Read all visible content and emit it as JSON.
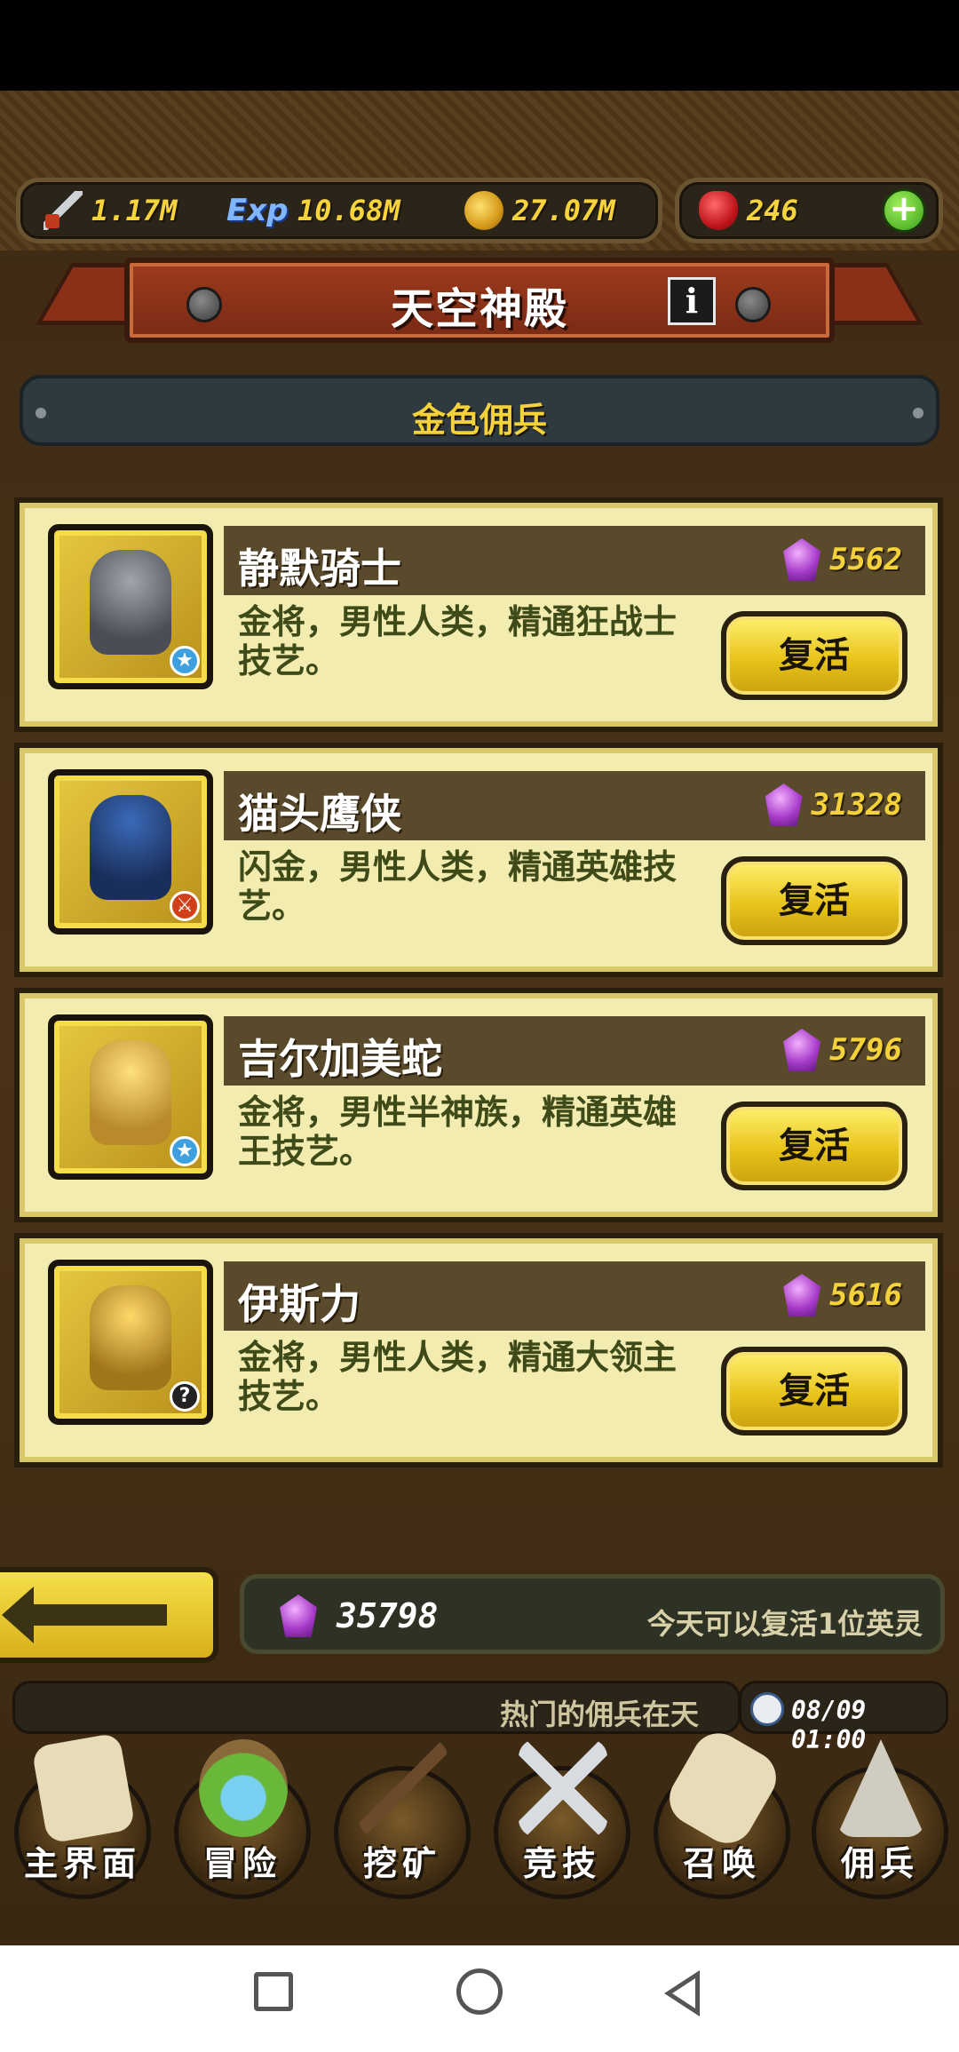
{
  "resources": {
    "attack": "1.17M",
    "exp_label": "Exp",
    "exp": "10.68M",
    "gold": "27.07M",
    "ruby": "246",
    "plus_label": "+"
  },
  "header": {
    "title": "天空神殿",
    "info_label": "i"
  },
  "category": {
    "label": "金色佣兵"
  },
  "heroes": [
    {
      "name": "静默骑士",
      "price": "5562",
      "desc": "金将，男性人类，精通狂战士技艺。",
      "button": "复活",
      "icon": "armor-knight-icon",
      "badge": "star-badge-icon"
    },
    {
      "name": "猫头鹰侠",
      "price": "31328",
      "desc": "闪金，男性人类，精通英雄技艺。",
      "button": "复活",
      "icon": "owl-hero-icon",
      "badge": "sword-badge-icon"
    },
    {
      "name": "吉尔加美蛇",
      "price": "5796",
      "desc": "金将，男性半神族，精通英雄王技艺。",
      "button": "复活",
      "icon": "golden-king-icon",
      "badge": "star-badge-icon"
    },
    {
      "name": "伊斯力",
      "price": "5616",
      "desc": "金将，男性人类，精通大领主技艺。",
      "button": "复活",
      "icon": "blond-lord-icon",
      "badge": "question-badge-icon"
    }
  ],
  "footer": {
    "gem_total": "35798",
    "note": "今天可以复活1位英灵",
    "ticker": "热门的佣兵在天",
    "time": "08/09 01:00"
  },
  "nav": [
    {
      "label": "主界面",
      "icon": "map-scroll-icon"
    },
    {
      "label": "冒险",
      "icon": "island-icon"
    },
    {
      "label": "挖矿",
      "icon": "pickaxe-icon"
    },
    {
      "label": "竞技",
      "icon": "crossed-swords-icon"
    },
    {
      "label": "召唤",
      "icon": "summon-scroll-icon"
    },
    {
      "label": "佣兵",
      "icon": "tent-icon"
    }
  ],
  "colors": {
    "accent_gold": "#f5d23a",
    "card_bg": "#f3ecb0",
    "banner_red": "#9c3a1e"
  }
}
